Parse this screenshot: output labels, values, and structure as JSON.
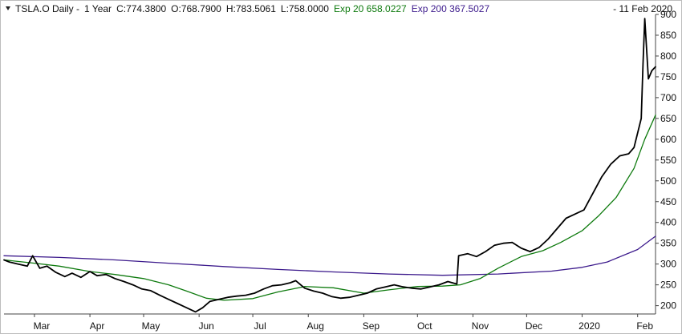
{
  "header": {
    "symbol": "TSLA.O Daily -",
    "period": "1 Year",
    "close": "C:774.3800",
    "open": "O:768.7900",
    "high": "H:783.5061",
    "low": "L:758.0000",
    "ema20": "Exp 20 658.0227",
    "ema200": "Exp 200 367.5027",
    "date": "- 11 Feb 2020"
  },
  "colors": {
    "price": "#000000",
    "ema20": "#0e7a0e",
    "ema200": "#3c1a8c",
    "axis": "#444444"
  },
  "chart_data": {
    "type": "line",
    "ylim": [
      180,
      900
    ],
    "yticks": [
      200,
      250,
      300,
      350,
      400,
      450,
      500,
      550,
      600,
      650,
      700,
      750,
      800,
      850,
      900
    ],
    "month_ticks": [
      {
        "label": "Mar",
        "date": "2019-03-01"
      },
      {
        "label": "Apr",
        "date": "2019-04-01"
      },
      {
        "label": "May",
        "date": "2019-05-01"
      },
      {
        "label": "Jun",
        "date": "2019-06-01"
      },
      {
        "label": "Jul",
        "date": "2019-07-01"
      },
      {
        "label": "Aug",
        "date": "2019-08-01"
      },
      {
        "label": "Sep",
        "date": "2019-09-01"
      },
      {
        "label": "Oct",
        "date": "2019-10-01"
      },
      {
        "label": "Nov",
        "date": "2019-11-01"
      },
      {
        "label": "Dec",
        "date": "2019-12-01"
      },
      {
        "label": "2020",
        "date": "2020-01-01"
      },
      {
        "label": "Feb",
        "date": "2020-02-01"
      }
    ],
    "series": [
      {
        "key": "price",
        "color": "#000000",
        "x": [
          "2019-02-12",
          "2019-02-15",
          "2019-02-20",
          "2019-02-25",
          "2019-02-28",
          "2019-03-04",
          "2019-03-08",
          "2019-03-13",
          "2019-03-18",
          "2019-03-22",
          "2019-03-27",
          "2019-04-01",
          "2019-04-05",
          "2019-04-10",
          "2019-04-15",
          "2019-04-20",
          "2019-04-25",
          "2019-04-30",
          "2019-05-05",
          "2019-05-10",
          "2019-05-15",
          "2019-05-20",
          "2019-05-25",
          "2019-05-30",
          "2019-06-03",
          "2019-06-07",
          "2019-06-12",
          "2019-06-17",
          "2019-06-22",
          "2019-06-27",
          "2019-07-02",
          "2019-07-07",
          "2019-07-12",
          "2019-07-17",
          "2019-07-22",
          "2019-07-25",
          "2019-07-30",
          "2019-08-04",
          "2019-08-09",
          "2019-08-14",
          "2019-08-19",
          "2019-08-24",
          "2019-08-29",
          "2019-09-03",
          "2019-09-08",
          "2019-09-13",
          "2019-09-18",
          "2019-09-23",
          "2019-09-28",
          "2019-10-03",
          "2019-10-08",
          "2019-10-13",
          "2019-10-18",
          "2019-10-23",
          "2019-10-24",
          "2019-10-29",
          "2019-11-03",
          "2019-11-08",
          "2019-11-13",
          "2019-11-18",
          "2019-11-23",
          "2019-11-28",
          "2019-12-03",
          "2019-12-08",
          "2019-12-13",
          "2019-12-18",
          "2019-12-23",
          "2019-12-28",
          "2020-01-02",
          "2020-01-07",
          "2020-01-12",
          "2020-01-17",
          "2020-01-22",
          "2020-01-27",
          "2020-01-30",
          "2020-02-03",
          "2020-02-04",
          "2020-02-05",
          "2020-02-07",
          "2020-02-09",
          "2020-02-11"
        ],
        "y": [
          310,
          305,
          300,
          295,
          320,
          290,
          295,
          280,
          270,
          278,
          268,
          282,
          272,
          275,
          265,
          258,
          250,
          240,
          236,
          225,
          215,
          205,
          195,
          185,
          195,
          210,
          215,
          220,
          223,
          225,
          230,
          240,
          248,
          250,
          255,
          260,
          242,
          235,
          230,
          222,
          218,
          220,
          225,
          230,
          240,
          245,
          250,
          245,
          242,
          240,
          245,
          250,
          258,
          252,
          320,
          325,
          318,
          330,
          345,
          350,
          352,
          338,
          330,
          340,
          360,
          385,
          410,
          420,
          430,
          470,
          510,
          540,
          560,
          565,
          580,
          650,
          780,
          890,
          745,
          765,
          774
        ]
      },
      {
        "key": "ema20",
        "color": "#0e7a0e",
        "x": [
          "2019-02-12",
          "2019-03-01",
          "2019-03-15",
          "2019-04-01",
          "2019-04-15",
          "2019-05-01",
          "2019-05-15",
          "2019-05-25",
          "2019-06-05",
          "2019-06-15",
          "2019-07-01",
          "2019-07-15",
          "2019-07-30",
          "2019-08-15",
          "2019-09-01",
          "2019-09-15",
          "2019-10-01",
          "2019-10-15",
          "2019-10-25",
          "2019-11-05",
          "2019-11-15",
          "2019-11-28",
          "2019-12-10",
          "2019-12-20",
          "2020-01-01",
          "2020-01-10",
          "2020-01-20",
          "2020-01-30",
          "2020-02-05",
          "2020-02-11"
        ],
        "y": [
          310,
          302,
          295,
          282,
          275,
          265,
          250,
          235,
          218,
          213,
          217,
          233,
          246,
          243,
          230,
          238,
          246,
          247,
          250,
          265,
          290,
          318,
          332,
          352,
          380,
          415,
          460,
          530,
          600,
          658
        ]
      },
      {
        "key": "ema200",
        "color": "#3c1a8c",
        "x": [
          "2019-02-12",
          "2019-03-15",
          "2019-04-15",
          "2019-05-15",
          "2019-06-15",
          "2019-07-15",
          "2019-08-15",
          "2019-09-15",
          "2019-10-15",
          "2019-11-15",
          "2019-12-15",
          "2020-01-01",
          "2020-01-15",
          "2020-02-01",
          "2020-02-11"
        ],
        "y": [
          320,
          316,
          310,
          302,
          294,
          287,
          281,
          276,
          273,
          276,
          283,
          292,
          305,
          335,
          367
        ]
      }
    ]
  }
}
